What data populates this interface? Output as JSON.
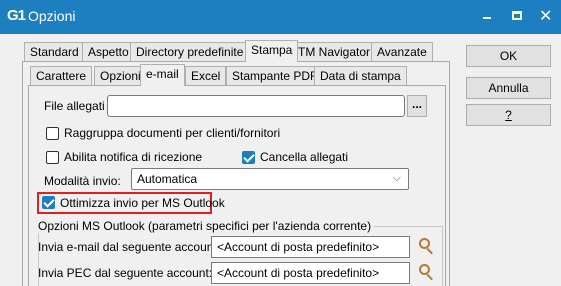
{
  "window": {
    "title": "Opzioni",
    "app_icon": "G1",
    "controls": [
      "minimize-icon",
      "maximize-icon",
      "close-icon"
    ]
  },
  "main_tabs": [
    "Standard",
    "Aspetto",
    "Directory predefinite",
    "Stampa",
    "TM Navigator",
    "Avanzate"
  ],
  "main_tab_active": "Stampa",
  "sub_tabs": [
    "Carattere",
    "Opzioni",
    "e-mail",
    "Excel",
    "Stampante PDF",
    "Data di stampa"
  ],
  "sub_tab_active": "e-mail",
  "email": {
    "file_allegati_label": "File allegati",
    "file_allegati_value": "",
    "browse_label": "...",
    "raggruppa_label": "Raggruppa documenti per clienti/fornitori",
    "raggruppa_checked": false,
    "notifica_label": "Abilita notifica di ricezione",
    "notifica_checked": false,
    "cancella_label": "Cancella allegati",
    "cancella_checked": true,
    "modalita_label": "Modalità invio:",
    "modalita_value": "Automatica",
    "ottimizza_label": "Ottimizza invio per MS Outlook",
    "ottimizza_checked": true,
    "outlook_group_title": "Opzioni MS Outlook (parametri specifici per l'azienda corrente)",
    "invia_email_label": "Invia e-mail dal seguente account:",
    "invia_email_value": "<Account di posta predefinito>",
    "invia_pec_label": "Invia PEC dal seguente account:",
    "invia_pec_value": "<Account di posta predefinito>"
  },
  "buttons": {
    "ok": "OK",
    "annulla": "Annulla",
    "help": "?"
  },
  "colors": {
    "titlebar": "#1e7fc0",
    "checkbox_checked": "#1e7fc0",
    "highlight_border": "#e0201c",
    "search_icon": "#b07a3a"
  }
}
